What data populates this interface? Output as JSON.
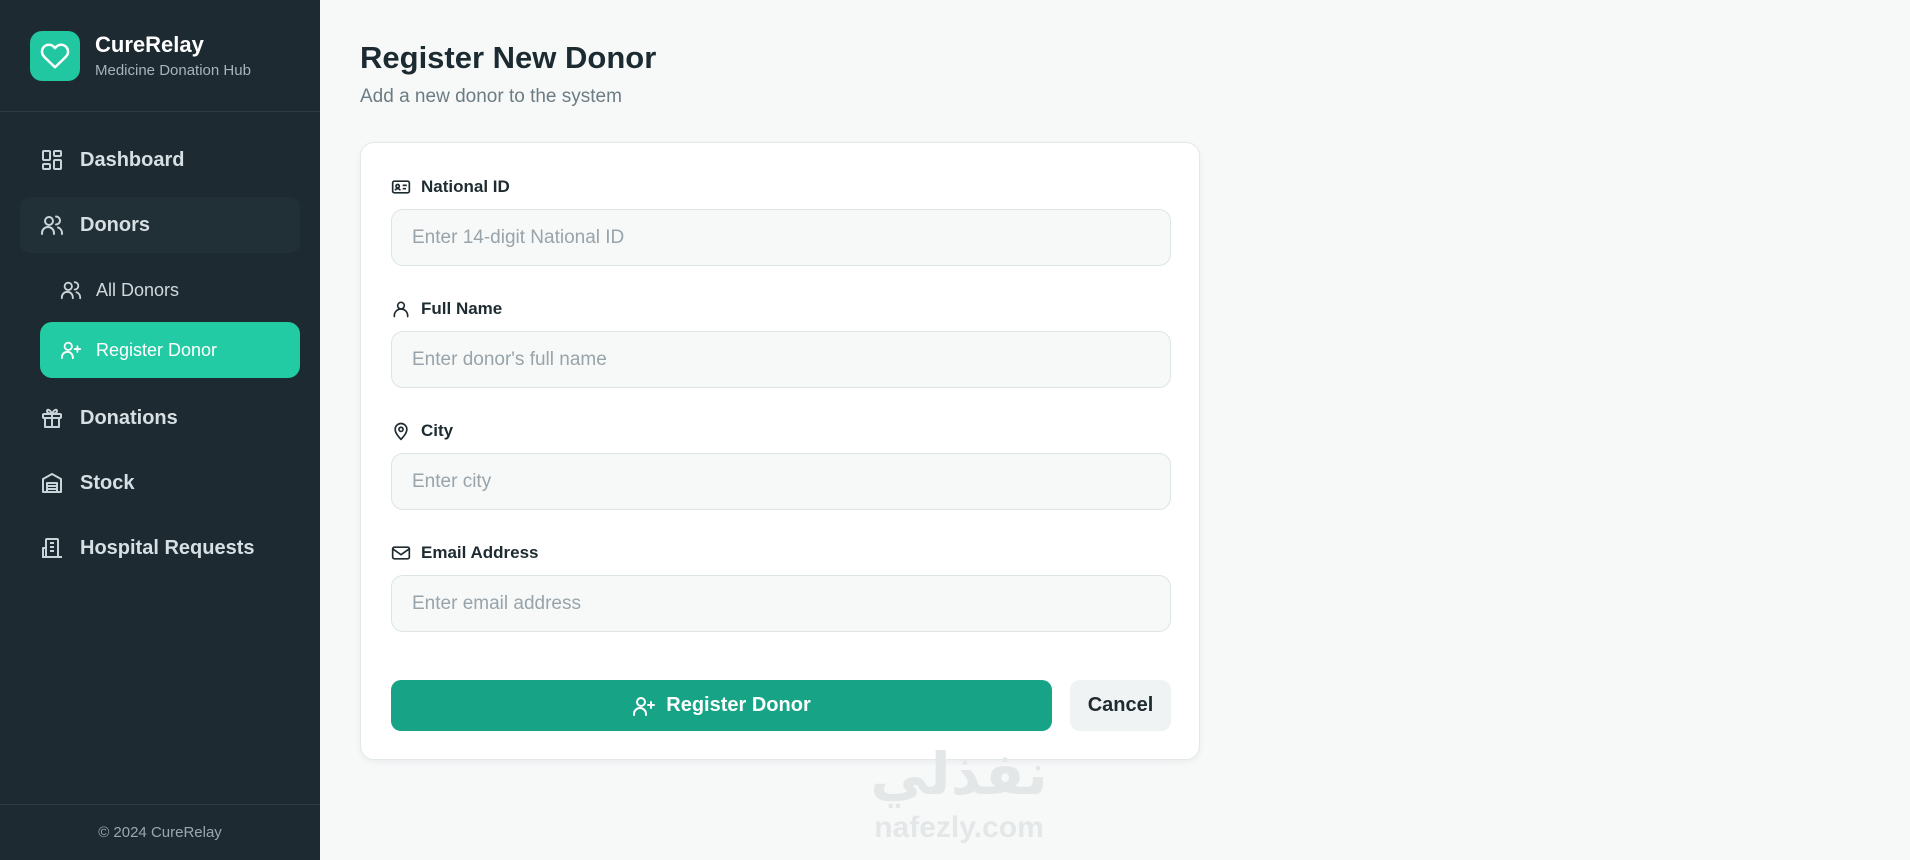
{
  "brand": {
    "name": "CureRelay",
    "tagline": "Medicine Donation Hub",
    "logo_icon": "heart-icon",
    "accent_color": "#21c7a0"
  },
  "sidebar": {
    "items": [
      {
        "label": "Dashboard",
        "icon": "dashboard-icon"
      },
      {
        "label": "Donors",
        "icon": "users-icon",
        "expanded": true,
        "children": [
          {
            "label": "All Donors",
            "icon": "users-icon"
          },
          {
            "label": "Register Donor",
            "icon": "user-plus-icon",
            "active": true
          }
        ]
      },
      {
        "label": "Donations",
        "icon": "gift-icon"
      },
      {
        "label": "Stock",
        "icon": "warehouse-icon"
      },
      {
        "label": "Hospital Requests",
        "icon": "hospital-icon"
      }
    ],
    "footer": "© 2024 CureRelay"
  },
  "page": {
    "title": "Register New Donor",
    "subtitle": "Add a new donor to the system"
  },
  "form": {
    "fields": [
      {
        "label": "National ID",
        "icon": "id-card-icon",
        "value": "",
        "placeholder": "Enter 14-digit National ID"
      },
      {
        "label": "Full Name",
        "icon": "user-icon",
        "value": "",
        "placeholder": "Enter donor's full name"
      },
      {
        "label": "City",
        "icon": "map-pin-icon",
        "value": "",
        "placeholder": "Enter city"
      },
      {
        "label": "Email Address",
        "icon": "mail-icon",
        "value": "",
        "placeholder": "Enter email address"
      }
    ],
    "submit_label": "Register Donor",
    "cancel_label": "Cancel",
    "primary_color": "#17a486"
  },
  "watermark": {
    "arabic": "نفذلي",
    "latin": "nafezly.com"
  }
}
